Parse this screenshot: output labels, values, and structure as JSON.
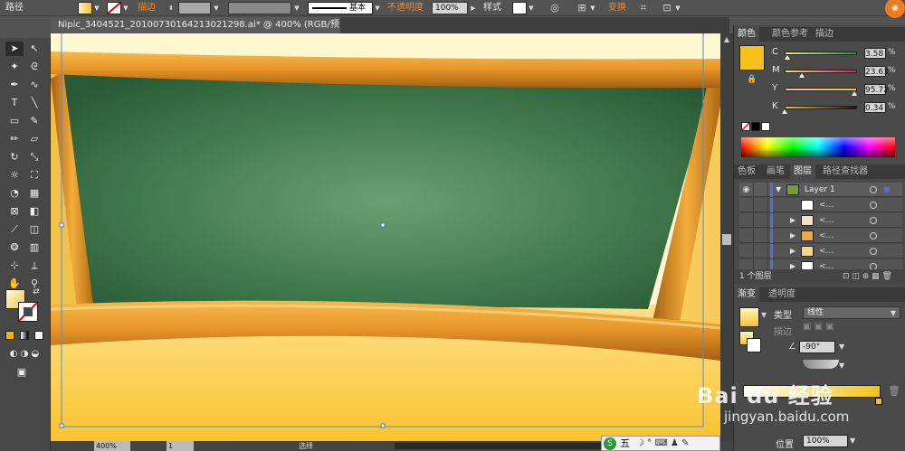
{
  "control_bar": {
    "mode_label": "路径",
    "stroke_label": "描边",
    "stroke_style": "基本",
    "opacity_label": "不透明度",
    "opacity_value": "100%",
    "style_label": "样式",
    "transform_label": "变换"
  },
  "document": {
    "tab_title": "Nipic_3404521_20100730164213021298.ai* @ 400% (RGB/预览)",
    "zoom": "400%",
    "page": "1",
    "status_text": "选择"
  },
  "color_panel": {
    "tabs": [
      "颜色",
      "颜色参考",
      "描边"
    ],
    "active_tab": 0,
    "fill_hex": "#f5c21a",
    "channels": [
      {
        "name": "C",
        "value": "3.58",
        "pct": 3.58,
        "grad": [
          "#f7e47a",
          "#2a8a3a"
        ]
      },
      {
        "name": "M",
        "value": "23.63",
        "pct": 23.63,
        "grad": [
          "#f7e47a",
          "#d11e6a"
        ]
      },
      {
        "name": "Y",
        "value": "95.72",
        "pct": 95.72,
        "grad": [
          "#f0b7c8",
          "#f3d200"
        ]
      },
      {
        "name": "K",
        "value": "0.34",
        "pct": 0.34,
        "grad": [
          "#f5c21a",
          "#111111"
        ]
      }
    ]
  },
  "layers_panel": {
    "tabs": [
      "色板",
      "画笔",
      "图层",
      "路径查找器"
    ],
    "active_tab": 2,
    "layer_name": "Layer 1",
    "sublayer_names": [
      "<...",
      "<...",
      "<...",
      "<...",
      "<..."
    ],
    "footer": "1 个图层"
  },
  "gradient_panel": {
    "tabs": [
      "渐变",
      "透明度"
    ],
    "active_tab": 0,
    "type_label": "类型",
    "type_value": "线性",
    "stroke_label": "描边",
    "angle_value": "-90°",
    "position_label": "位置",
    "position_value": "100%"
  },
  "taskbar": {
    "ime_label": "五"
  },
  "watermark": "Bai du 经验 jingyan.baidu.com"
}
